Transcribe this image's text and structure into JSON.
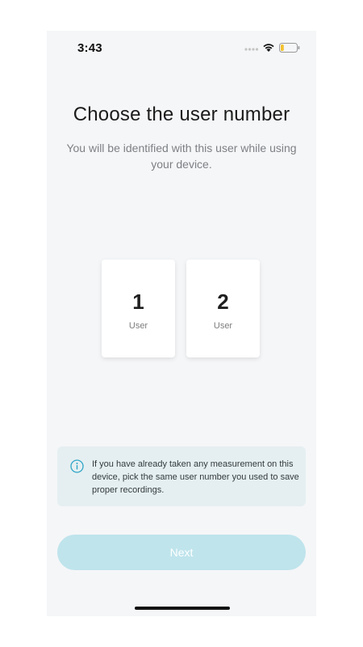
{
  "status_bar": {
    "time": "3:43",
    "signal_icon": "signal-dots-icon",
    "wifi_icon": "wifi-icon",
    "battery_icon": "battery-icon",
    "battery_level": 0.2,
    "battery_color": "#f2c230"
  },
  "header": {
    "title": "Choose the user number",
    "subtitle": "You will be identified with this user while using your device."
  },
  "users": [
    {
      "number": "1",
      "label": "User"
    },
    {
      "number": "2",
      "label": "User"
    }
  ],
  "info": {
    "icon": "info-icon",
    "icon_color": "#2fa5c7",
    "text": "If you have already taken any measurement on this device, pick the same user number you used to save proper recordings."
  },
  "footer": {
    "next_label": "Next",
    "button_color": "#bfe4ec"
  },
  "colors": {
    "background": "#f5f6f8",
    "info_background": "#e5eff1"
  }
}
